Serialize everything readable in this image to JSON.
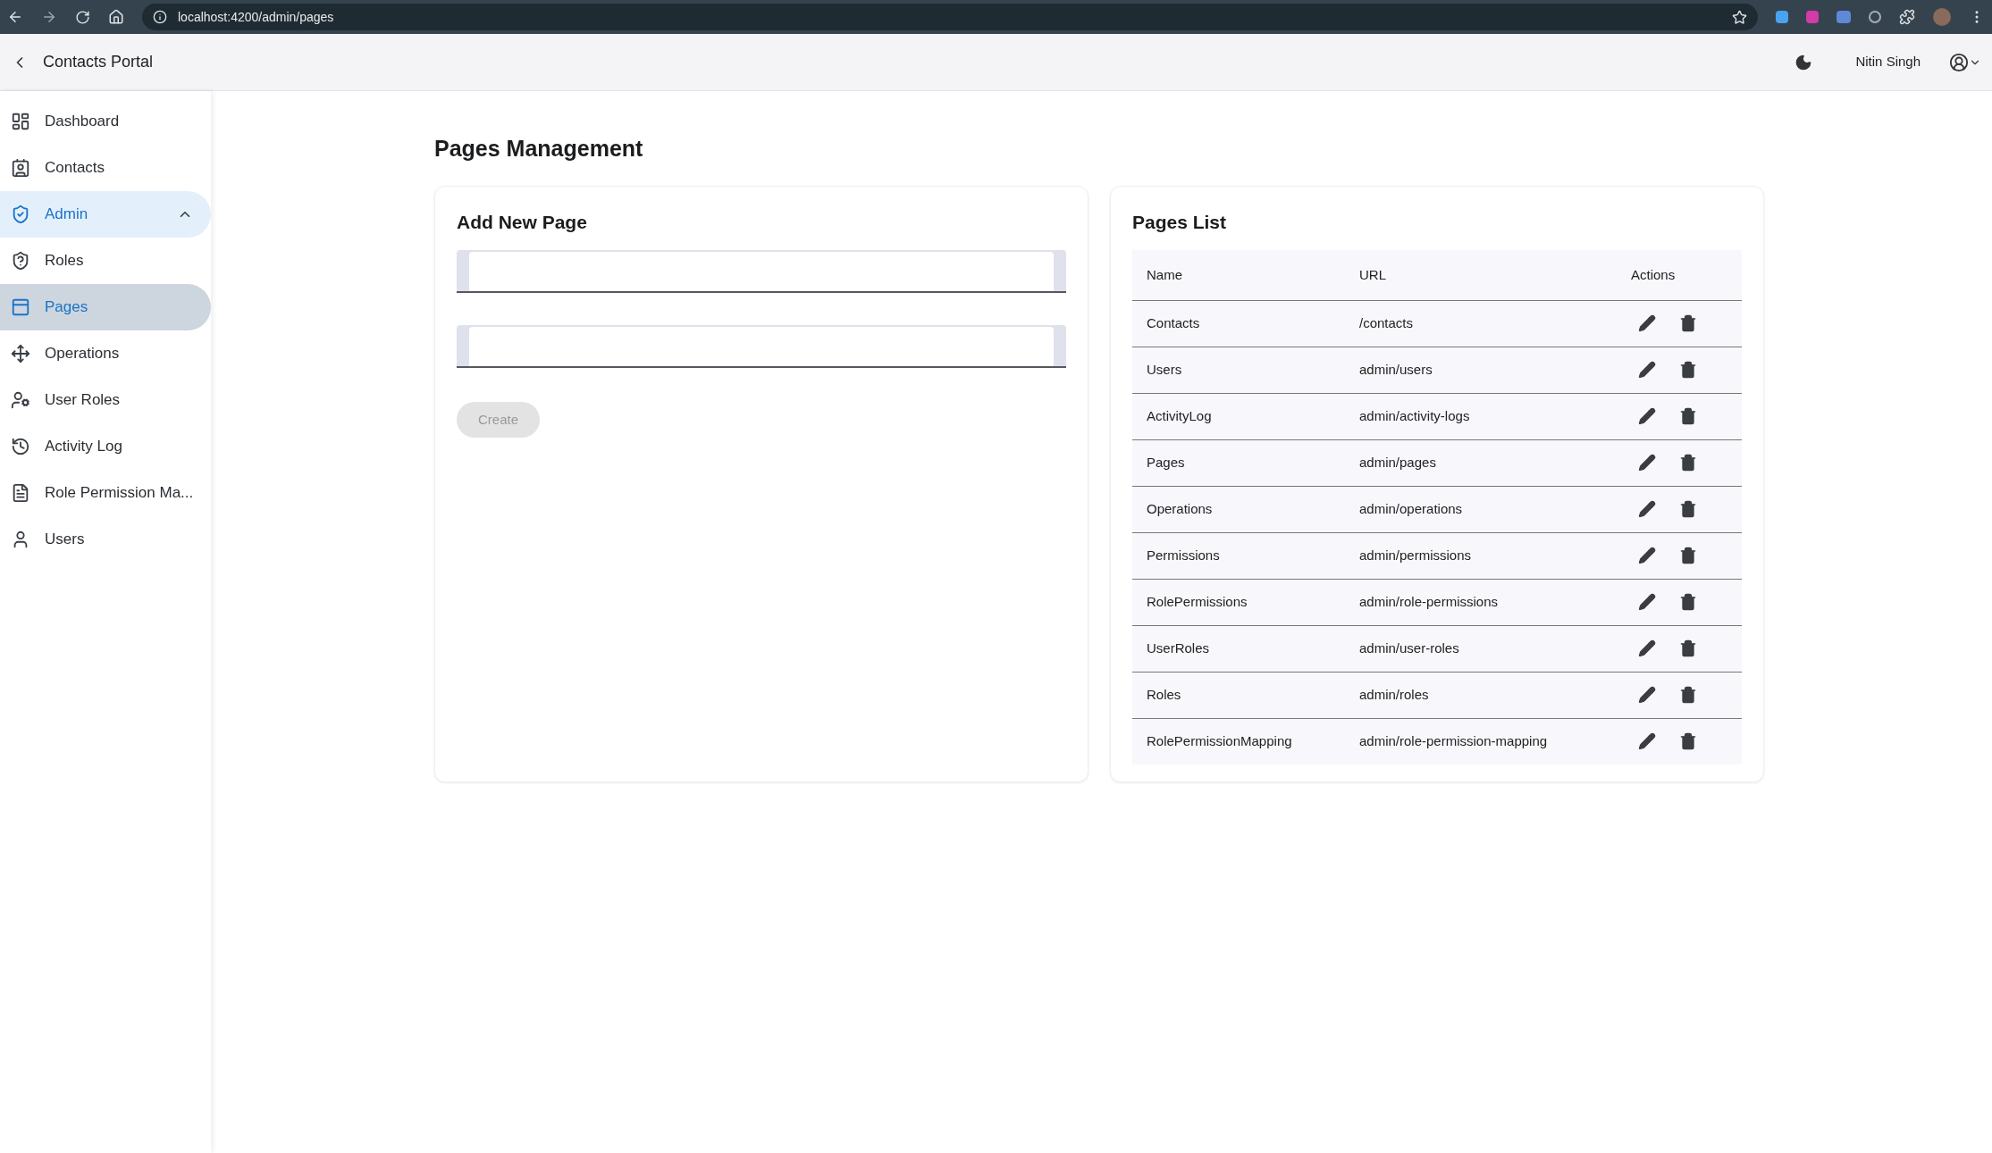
{
  "browser": {
    "url": "localhost:4200/admin/pages"
  },
  "header": {
    "title": "Contacts Portal",
    "user": "Nitin Singh"
  },
  "sidebar": {
    "items": [
      {
        "label": "Dashboard",
        "selected": false
      },
      {
        "label": "Contacts",
        "selected": false
      },
      {
        "label": "Admin",
        "kind": "group",
        "expanded": true,
        "selected": false
      },
      {
        "label": "Roles",
        "selected": false
      },
      {
        "label": "Pages",
        "selected": true
      },
      {
        "label": "Operations",
        "selected": false
      },
      {
        "label": "User Roles",
        "selected": false
      },
      {
        "label": "Activity Log",
        "selected": false
      },
      {
        "label": "Role Permission Ma...",
        "selected": false
      },
      {
        "label": "Users",
        "selected": false
      }
    ]
  },
  "main": {
    "title": "Pages Management",
    "form": {
      "title": "Add New Page",
      "button": {
        "label": "Create",
        "disabled": true
      }
    },
    "list": {
      "title": "Pages List",
      "columns": [
        "Name",
        "URL",
        "Actions"
      ],
      "rows": [
        {
          "name": "Contacts",
          "url": "/contacts"
        },
        {
          "name": "Users",
          "url": "admin/users"
        },
        {
          "name": "ActivityLog",
          "url": "admin/activity-logs"
        },
        {
          "name": "Pages",
          "url": "admin/pages"
        },
        {
          "name": "Operations",
          "url": "admin/operations"
        },
        {
          "name": "Permissions",
          "url": "admin/permissions"
        },
        {
          "name": "RolePermissions",
          "url": "admin/role-permissions"
        },
        {
          "name": "UserRoles",
          "url": "admin/user-roles"
        },
        {
          "name": "Roles",
          "url": "admin/roles"
        },
        {
          "name": "RolePermissionMapping",
          "url": "admin/role-permission-mapping"
        }
      ]
    }
  }
}
